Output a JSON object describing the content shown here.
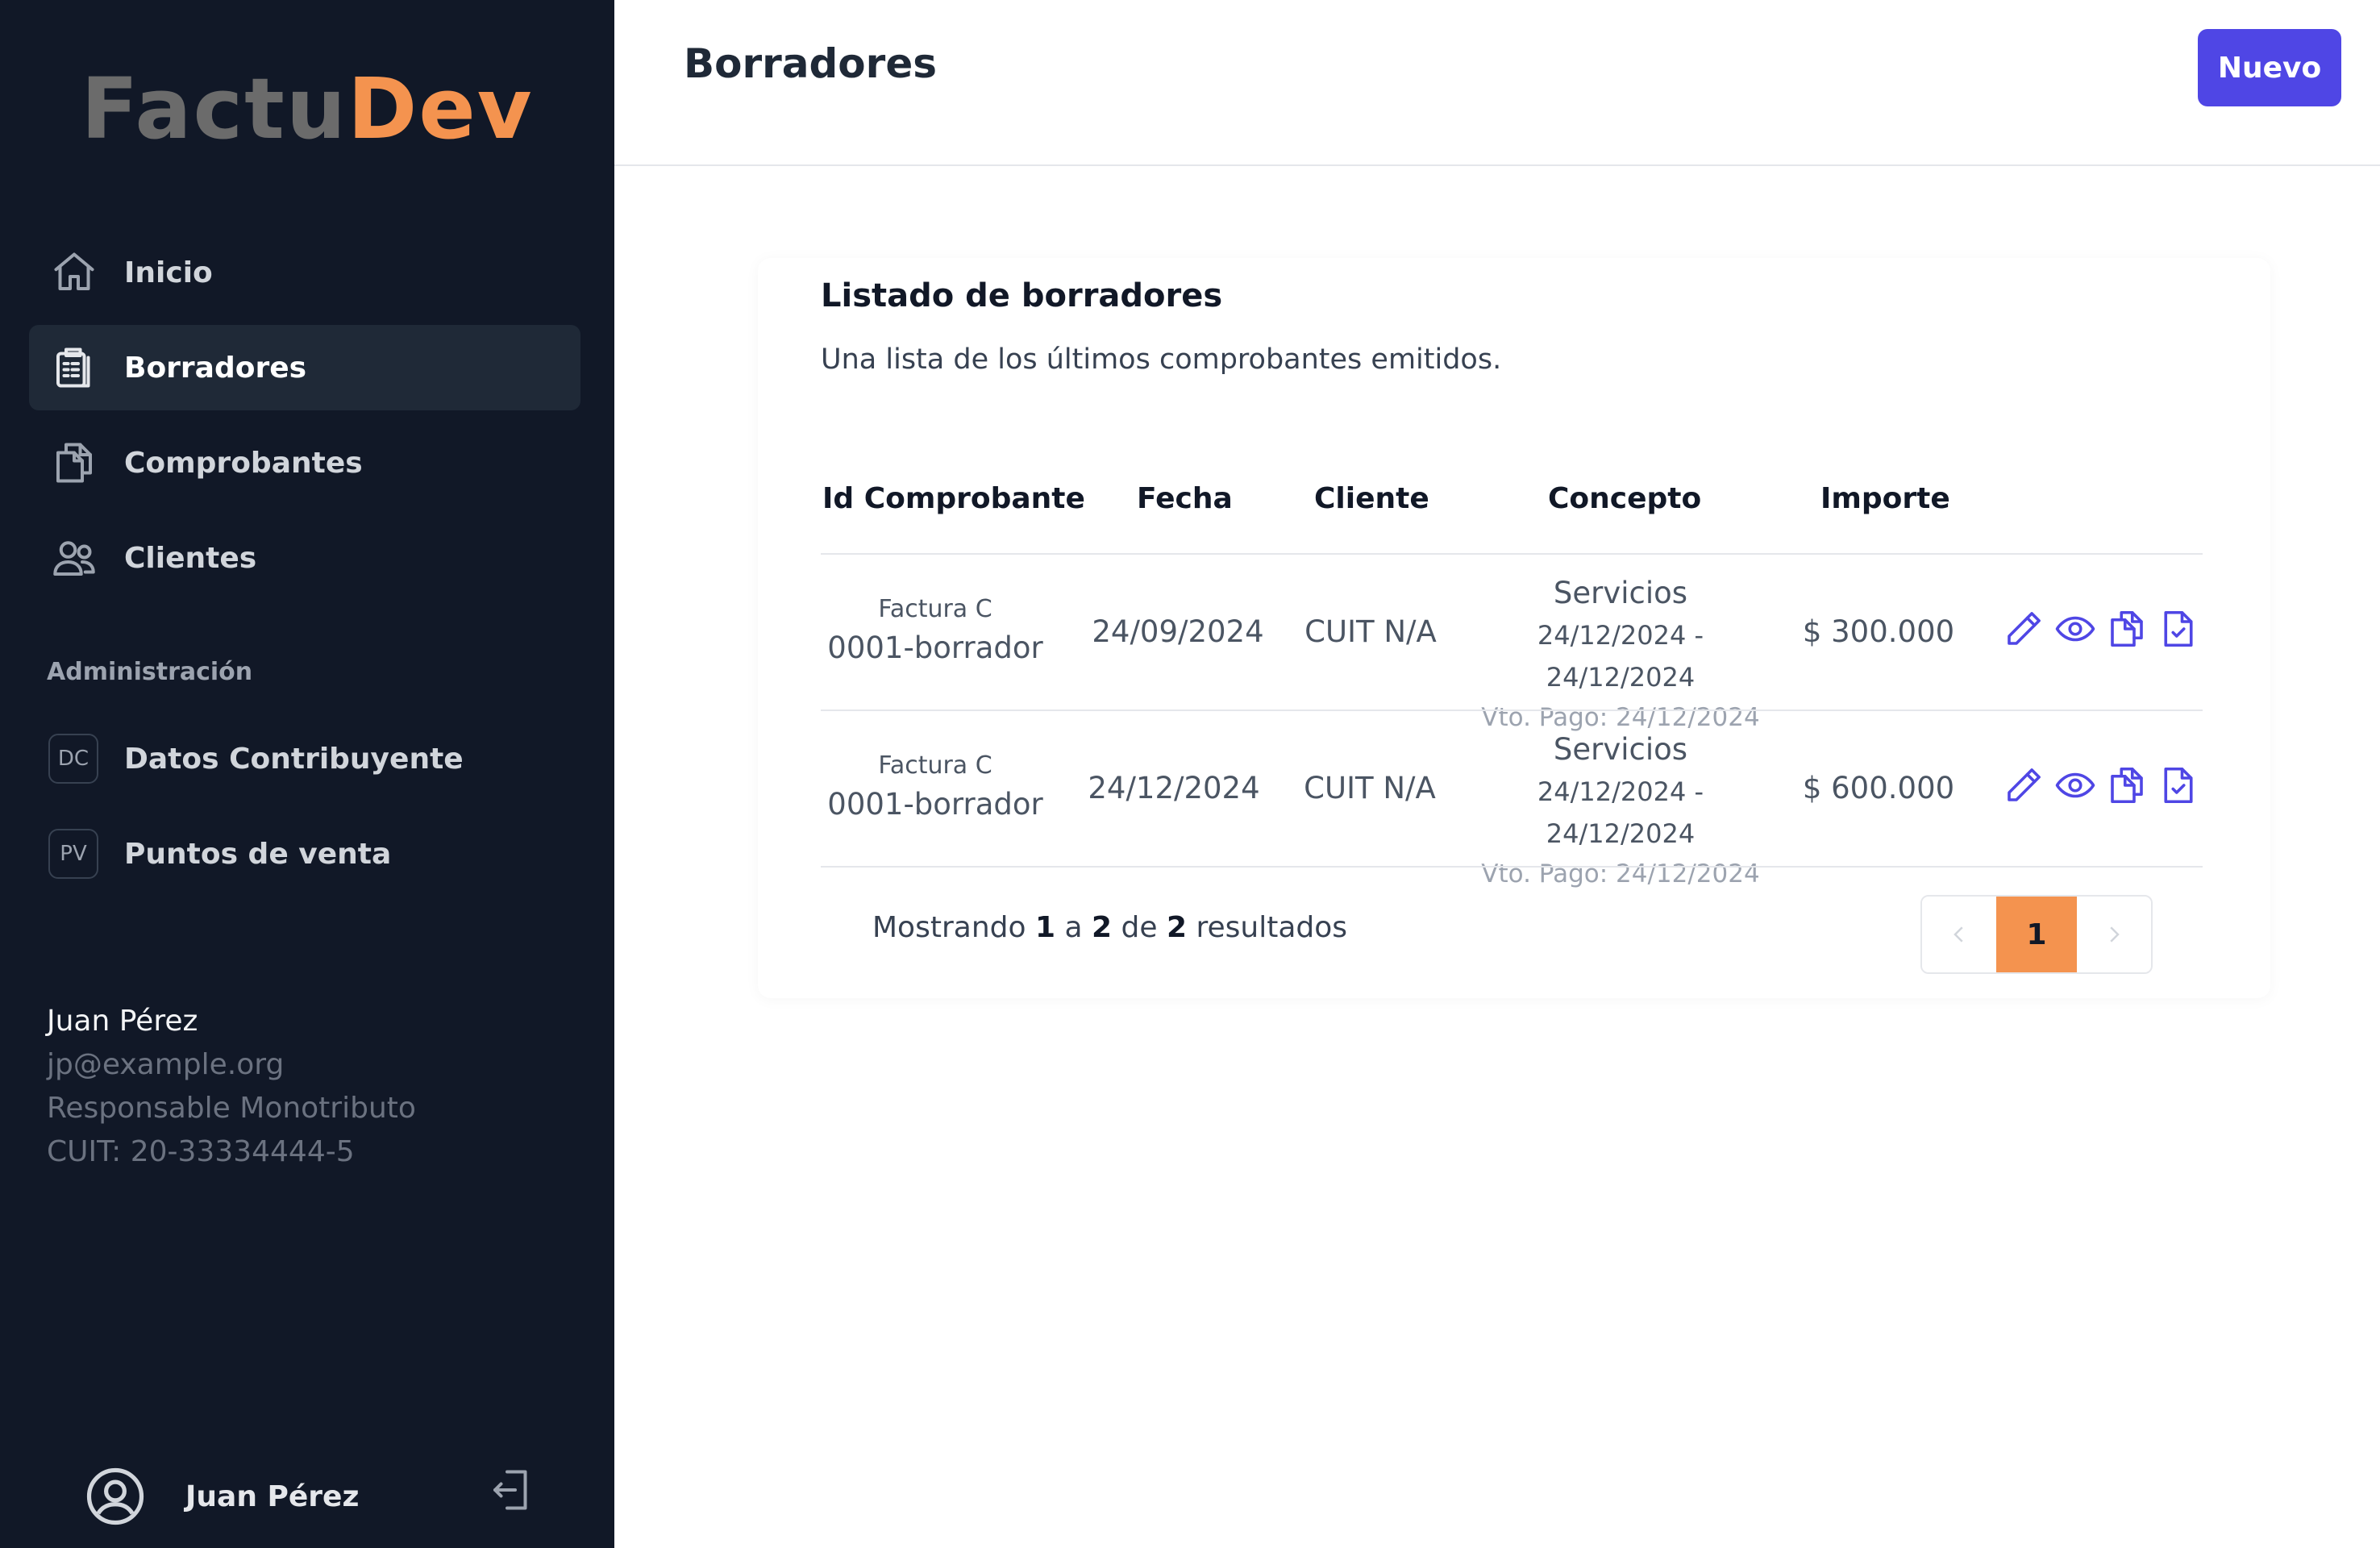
{
  "app": {
    "logo_part1": "Factu",
    "logo_part2": "Dev",
    "brand_color": "#f4934f",
    "accent_color": "#4f46e5"
  },
  "sidebar": {
    "items": [
      {
        "label": "Inicio",
        "icon": "home-icon"
      },
      {
        "label": "Borradores",
        "icon": "clipboard-icon",
        "active": true
      },
      {
        "label": "Comprobantes",
        "icon": "documents-icon"
      },
      {
        "label": "Clientes",
        "icon": "users-icon"
      }
    ],
    "section_title": "Administración",
    "admin_items": [
      {
        "badge": "DC",
        "label": "Datos Contribuyente"
      },
      {
        "badge": "PV",
        "label": "Puntos de venta"
      }
    ],
    "user": {
      "name": "Juan Pérez",
      "email": "jp@example.org",
      "category": "Responsable Monotributo",
      "cuit": "CUIT: 20-33334444-5"
    },
    "footer_name": "Juan Pérez"
  },
  "header": {
    "title": "Borradores",
    "new_button": "Nuevo"
  },
  "card": {
    "title": "Listado de borradores",
    "subtitle": "Una lista de los últimos comprobantes emitidos.",
    "columns": [
      "Id Comprobante",
      "Fecha",
      "Cliente",
      "Concepto",
      "Importe"
    ],
    "rows": [
      {
        "tipo": "Factura C",
        "numero": "0001-borrador",
        "fecha": "24/09/2024",
        "cliente": "CUIT N/A",
        "concepto": "Servicios",
        "periodo": "24/12/2024 - 24/12/2024",
        "vto": "Vto. Pago: 24/12/2024",
        "importe": "$ 300.000"
      },
      {
        "tipo": "Factura C",
        "numero": "0001-borrador",
        "fecha": "24/12/2024",
        "cliente": "CUIT N/A",
        "concepto": "Servicios",
        "periodo": "24/12/2024 - 24/12/2024",
        "vto": "Vto. Pago: 24/12/2024",
        "importe": "$ 600.000"
      }
    ],
    "footer": {
      "mostrando": "Mostrando",
      "desde": "1",
      "a": "a",
      "hasta": "2",
      "de": "de",
      "total": "2",
      "resultados": "resultados"
    },
    "pagination": {
      "current": "1"
    }
  }
}
